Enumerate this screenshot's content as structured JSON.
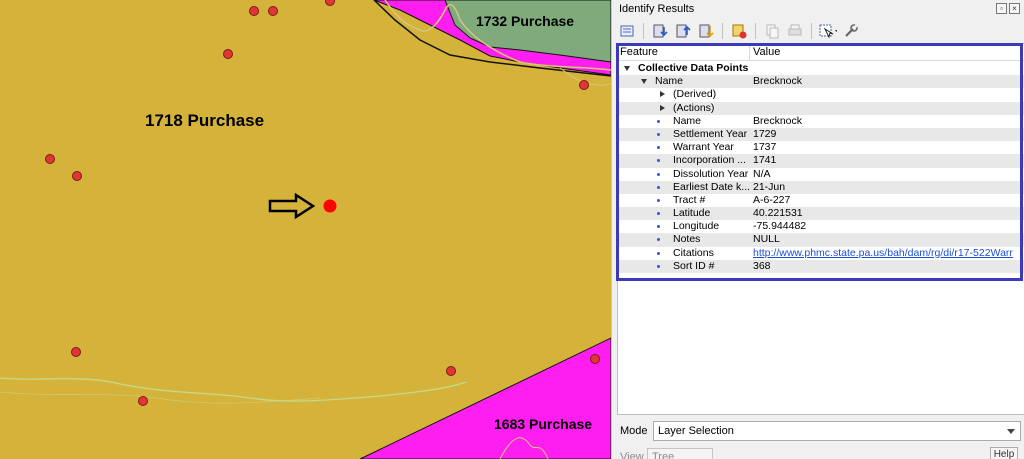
{
  "map": {
    "labels": {
      "purchase_1718": "1718 Purchase",
      "purchase_1732": "1732 Purchase",
      "purchase_1683": "1683 Purchase"
    },
    "colors": {
      "purchase_1718": "#d5b33b",
      "purchase_1732": "#7faa7c",
      "purchase_1683": "#ff1ef0",
      "points": "#e23636",
      "selected_point": "#ff0000",
      "streams": "#c5d98a"
    },
    "selected_point_icon": "arrow-right-icon"
  },
  "panel": {
    "title": "Identify Results",
    "toolbar_icons": [
      "expand-tree-icon",
      "expand-new-results-icon",
      "collapse-icon",
      "expand-all-icon",
      "clear-results-icon",
      "copy-icon",
      "print-icon",
      "select-features-icon",
      "settings-icon"
    ],
    "table": {
      "header_feature": "Feature",
      "header_value": "Value",
      "layer": "Collective Data Points",
      "feature_key": "Name",
      "feature_value": "Brecknock",
      "derived": "(Derived)",
      "actions": "(Actions)",
      "attributes": [
        {
          "name": "Name",
          "value": "Brecknock"
        },
        {
          "name": "Settlement Year",
          "value": "1729"
        },
        {
          "name": "Warrant Year",
          "value": "1737"
        },
        {
          "name": "Incorporation ...",
          "value": "1741"
        },
        {
          "name": "Dissolution Year",
          "value": "N/A"
        },
        {
          "name": "Earliest Date k...",
          "value": "21-Jun"
        },
        {
          "name": "Tract #",
          "value": "A-6-227"
        },
        {
          "name": "Latitude",
          "value": "40.221531"
        },
        {
          "name": "Longitude",
          "value": "-75.944482"
        },
        {
          "name": "Notes",
          "value": "NULL"
        },
        {
          "name": "Citations",
          "value": "http://www.phmc.state.pa.us/bah/dam/rg/di/r17-522Warr"
        },
        {
          "name": "Sort ID #",
          "value": "368"
        }
      ]
    },
    "mode_label": "Mode",
    "mode_value": "Layer Selection",
    "view_label": "View",
    "view_value": "Tree",
    "help_label": "Help"
  }
}
